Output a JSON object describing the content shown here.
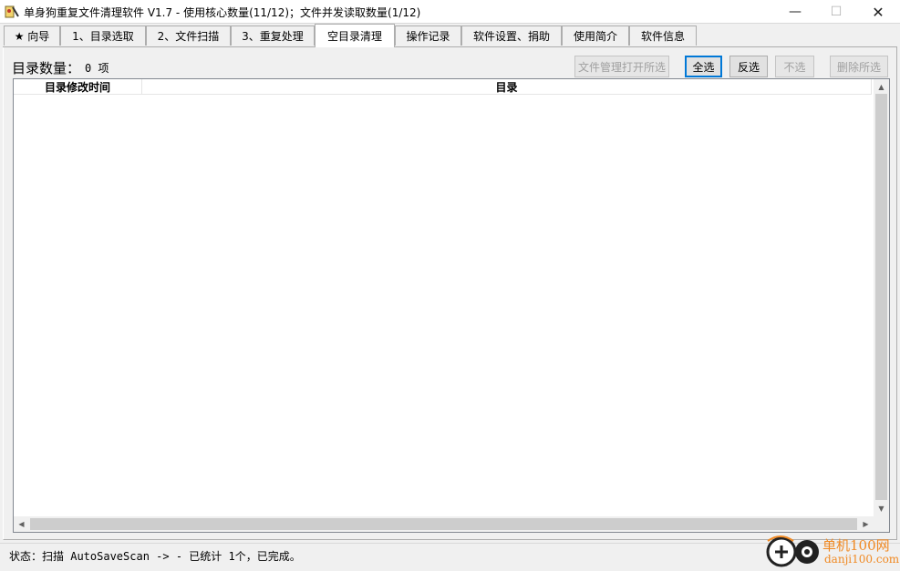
{
  "window": {
    "title": "单身狗重复文件清理软件 V1.7  -  使用核心数量(11/12)；文件并发读取数量(1/12)",
    "min_glyph": "—",
    "max_glyph": "☐",
    "close_glyph": "✕"
  },
  "tabs": [
    {
      "label": "★ 向导"
    },
    {
      "label": "1、目录选取"
    },
    {
      "label": "2、文件扫描"
    },
    {
      "label": "3、重复处理"
    },
    {
      "label": "空目录清理"
    },
    {
      "label": "操作记录"
    },
    {
      "label": "软件设置、捐助"
    },
    {
      "label": "使用简介"
    },
    {
      "label": "软件信息"
    }
  ],
  "active_tab": "空目录清理",
  "panel": {
    "count_label": "目录数量：",
    "count_value": "0 项",
    "buttons": {
      "open_in_explorer": "文件管理打开所选",
      "select_all": "全选",
      "invert_selection": "反选",
      "select_none": "不选",
      "delete_selected": "删除所选"
    },
    "columns": [
      "目录修改时间",
      "目录"
    ],
    "rows": []
  },
  "status": {
    "text": "状态：扫描 AutoSaveScan -> - 已统计 1个，已完成。"
  },
  "watermark": {
    "line1": "单机100网",
    "line2": "danji100.com"
  },
  "colors": {
    "accent_focus": "#0078d7",
    "watermark": "#f08a24"
  }
}
